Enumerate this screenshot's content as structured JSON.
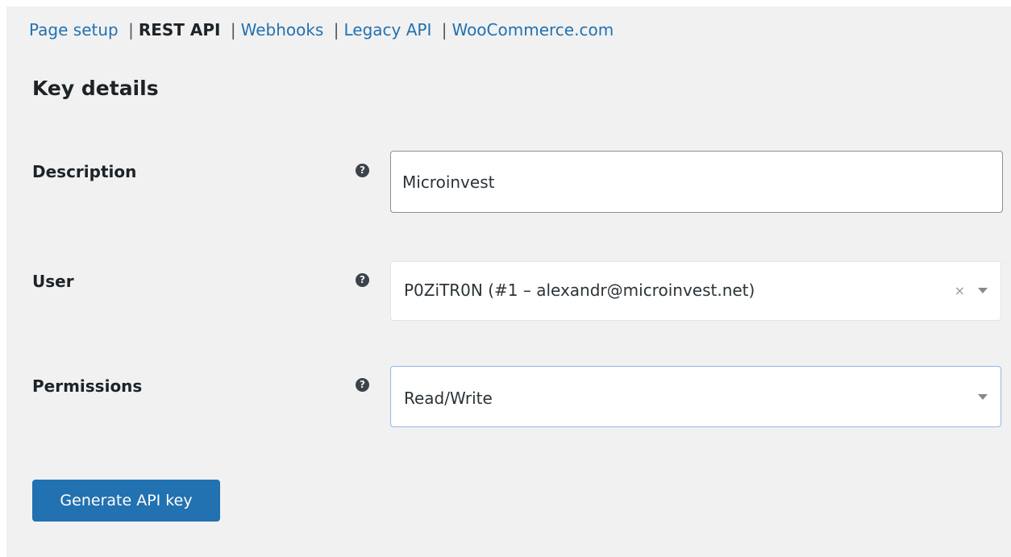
{
  "subnav": {
    "items": [
      {
        "label": "Page setup",
        "current": false
      },
      {
        "label": "REST API",
        "current": true
      },
      {
        "label": "Webhooks",
        "current": false
      },
      {
        "label": "Legacy API",
        "current": false
      },
      {
        "label": "WooCommerce.com",
        "current": false
      }
    ],
    "separator": "|"
  },
  "section": {
    "title": "Key details"
  },
  "form": {
    "description": {
      "label": "Description",
      "help_icon": "question-circle-icon",
      "value": "Microinvest"
    },
    "user": {
      "label": "User",
      "help_icon": "question-circle-icon",
      "selected": "P0ZiTR0N (#1 – alexandr@microinvest.net)",
      "clear_symbol": "×"
    },
    "permissions": {
      "label": "Permissions",
      "help_icon": "question-circle-icon",
      "selected": "Read/Write"
    }
  },
  "actions": {
    "generate_label": "Generate API key"
  },
  "colors": {
    "link": "#2271b1",
    "primary_button": "#2271b1",
    "panel_background": "#f1f1f1",
    "focus_border": "#93b7e8"
  }
}
